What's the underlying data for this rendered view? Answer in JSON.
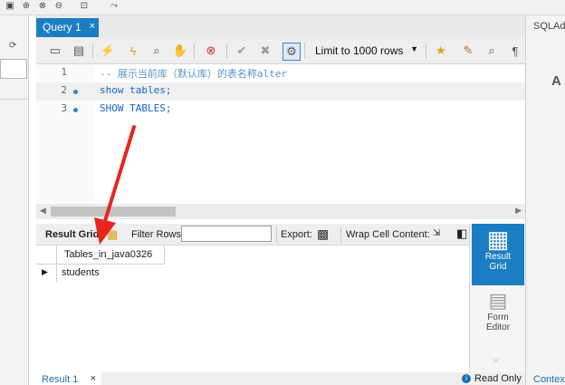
{
  "tabs": {
    "query_tab": "Query 1",
    "close_glyph": "×"
  },
  "toolbar": {
    "limit_select": "Limit to 1000 rows",
    "icons": [
      "open-folder-icon",
      "save-icon",
      "execute-icon",
      "execute-current-icon",
      "explain-icon",
      "stop-icon",
      "toggle-error-icon",
      "commit-icon",
      "rollback-icon",
      "autocommit-icon",
      "limit-dropdown",
      "bookmark-icon",
      "beautify-icon",
      "find-icon",
      "invisible-chars-icon"
    ]
  },
  "editor": {
    "lines": [
      {
        "no": "1",
        "text": "-- 展示当前库（默认库）的表名称alter"
      },
      {
        "no": "2",
        "text": "show tables;"
      },
      {
        "no": "3",
        "text": "SHOW TABLES;"
      }
    ]
  },
  "result_toolbar": {
    "result_grid": "Result Grid",
    "filter_rows": "Filter Rows:",
    "export": "Export:",
    "wrap": "Wrap Cell Content:"
  },
  "grid": {
    "column": "Tables_in_java0326",
    "rows": [
      "students"
    ]
  },
  "side_panel": {
    "result_grid_l1": "Result",
    "result_grid_l2": "Grid",
    "form_editor_l1": "Form",
    "form_editor_l2": "Editor"
  },
  "bottom": {
    "tab": "Result 1",
    "read_only": "Read Only"
  },
  "right_panel": {
    "tab": "SQLAd",
    "big_text": "A",
    "context": "Contex"
  },
  "colors": {
    "accent": "#1c7ec2",
    "keyword": "#1a64c9",
    "comment": "#5b94c7",
    "arrow": "#e8251f"
  }
}
